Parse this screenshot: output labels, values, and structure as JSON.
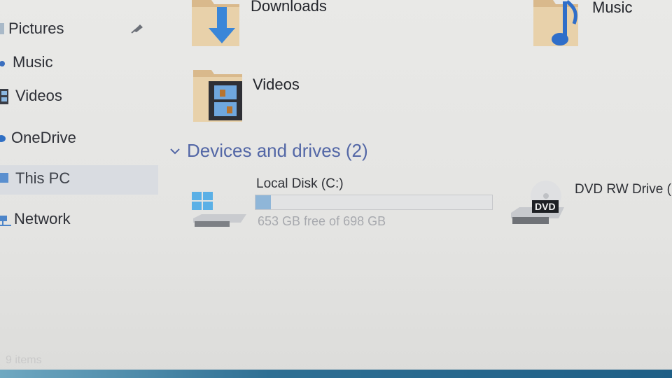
{
  "sidebar": {
    "items": [
      {
        "label": "Pictures"
      },
      {
        "label": "Music"
      },
      {
        "label": "Videos"
      },
      {
        "label": "OneDrive"
      },
      {
        "label": "This PC",
        "selected": true
      },
      {
        "label": "Network"
      }
    ]
  },
  "folders": [
    {
      "label": "Downloads",
      "icon": "download-folder-icon"
    },
    {
      "label": "Music",
      "icon": "music-folder-icon"
    },
    {
      "label": "Videos",
      "icon": "videos-folder-icon"
    }
  ],
  "devices": {
    "header": "Devices and drives (2)",
    "drives": [
      {
        "name": "Local Disk (C:)",
        "free_text": "653 GB free of 698 GB",
        "used_fraction": 0.064,
        "icon": "windows-drive-icon"
      },
      {
        "name": "DVD RW Drive (",
        "icon": "dvd-drive-icon",
        "badge": "DVD"
      }
    ]
  },
  "status": {
    "items_text": "9 items"
  },
  "colors": {
    "accent": "#5367a6",
    "capacity_fill": "#8fb6d8"
  }
}
